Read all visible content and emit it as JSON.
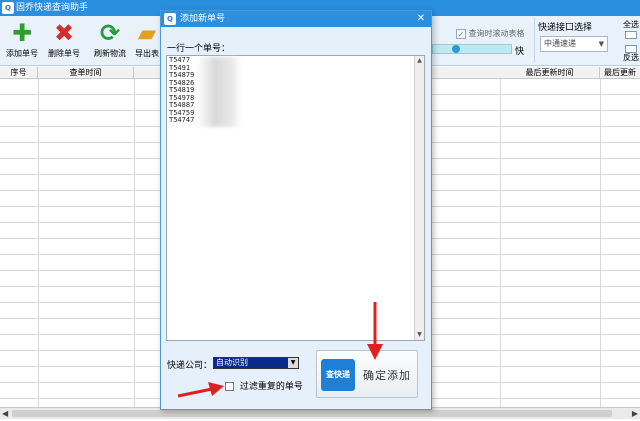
{
  "app": {
    "title": "固乔快递查询助手",
    "icon_text": "Q"
  },
  "toolbar": {
    "add_label": "添加单号",
    "delete_label": "删除单号",
    "refresh_label": "刷新物流",
    "export_label": "导出表",
    "icons": [
      "plus-icon",
      "x-icon",
      "refresh-icon",
      "folder-icon"
    ]
  },
  "options": {
    "scroll_check_label": "查询时滚动表格",
    "scroll_checked": true,
    "speed_label": "快",
    "interface_title": "快递接口选择",
    "interface_value": "中通速递",
    "select_all": "全选",
    "invert_select": "反选"
  },
  "table": {
    "columns": [
      "序号",
      "查单时间",
      "最后更新时间",
      "最后更新"
    ]
  },
  "dialog": {
    "title": "添加新单号",
    "prompt": "一行一个单号：",
    "tracking_numbers": [
      "T5477",
      "T5491",
      "T54879",
      "T54826",
      "T54819",
      "T54978",
      "T54887",
      "T54759",
      "T54747"
    ],
    "courier_label": "快递公司：",
    "courier_value": "自动识别",
    "dedup_label": "过滤重复的单号",
    "dedup_checked": false,
    "confirm_label": "确定添加",
    "confirm_logo_text": "查快递"
  },
  "colors": {
    "titlebar": "#2b8fe0",
    "annotation_arrow": "#e02020",
    "dialog_bg": "#e6f0fb"
  }
}
